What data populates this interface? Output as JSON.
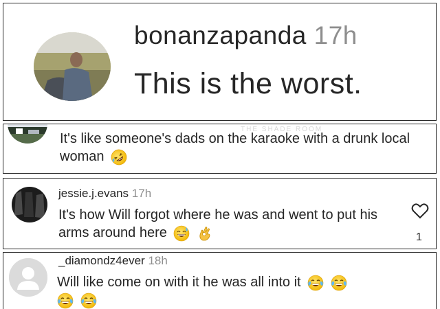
{
  "comments": [
    {
      "username": "bonanzapanda",
      "time": "17h",
      "text": "This is the worst."
    },
    {
      "text": "It's like someone's dads on the karaoke with a drunk local woman",
      "watermark": "THE SHADE ROOM",
      "emojis": [
        "rolling-on-floor-laughing"
      ]
    },
    {
      "username": "jessie.j.evans",
      "time": "17h",
      "text": "It's how Will forgot where he was and went to put his arms around here",
      "likes": "1",
      "emojis": [
        "grinning-sweat",
        "ok-hand"
      ]
    },
    {
      "username": "_diamondz4ever",
      "time": "18h",
      "text": "Will like come on with it he was all into it",
      "emojis": [
        "tears-of-joy",
        "tears-of-joy",
        "tears-of-joy",
        "tears-of-joy"
      ]
    }
  ],
  "icons": {
    "heart": "heart-outline-icon",
    "default_avatar": "default-avatar-icon"
  },
  "colors": {
    "text": "#262626",
    "timestamp": "#8e8e8e",
    "border": "#2a2a2a"
  }
}
